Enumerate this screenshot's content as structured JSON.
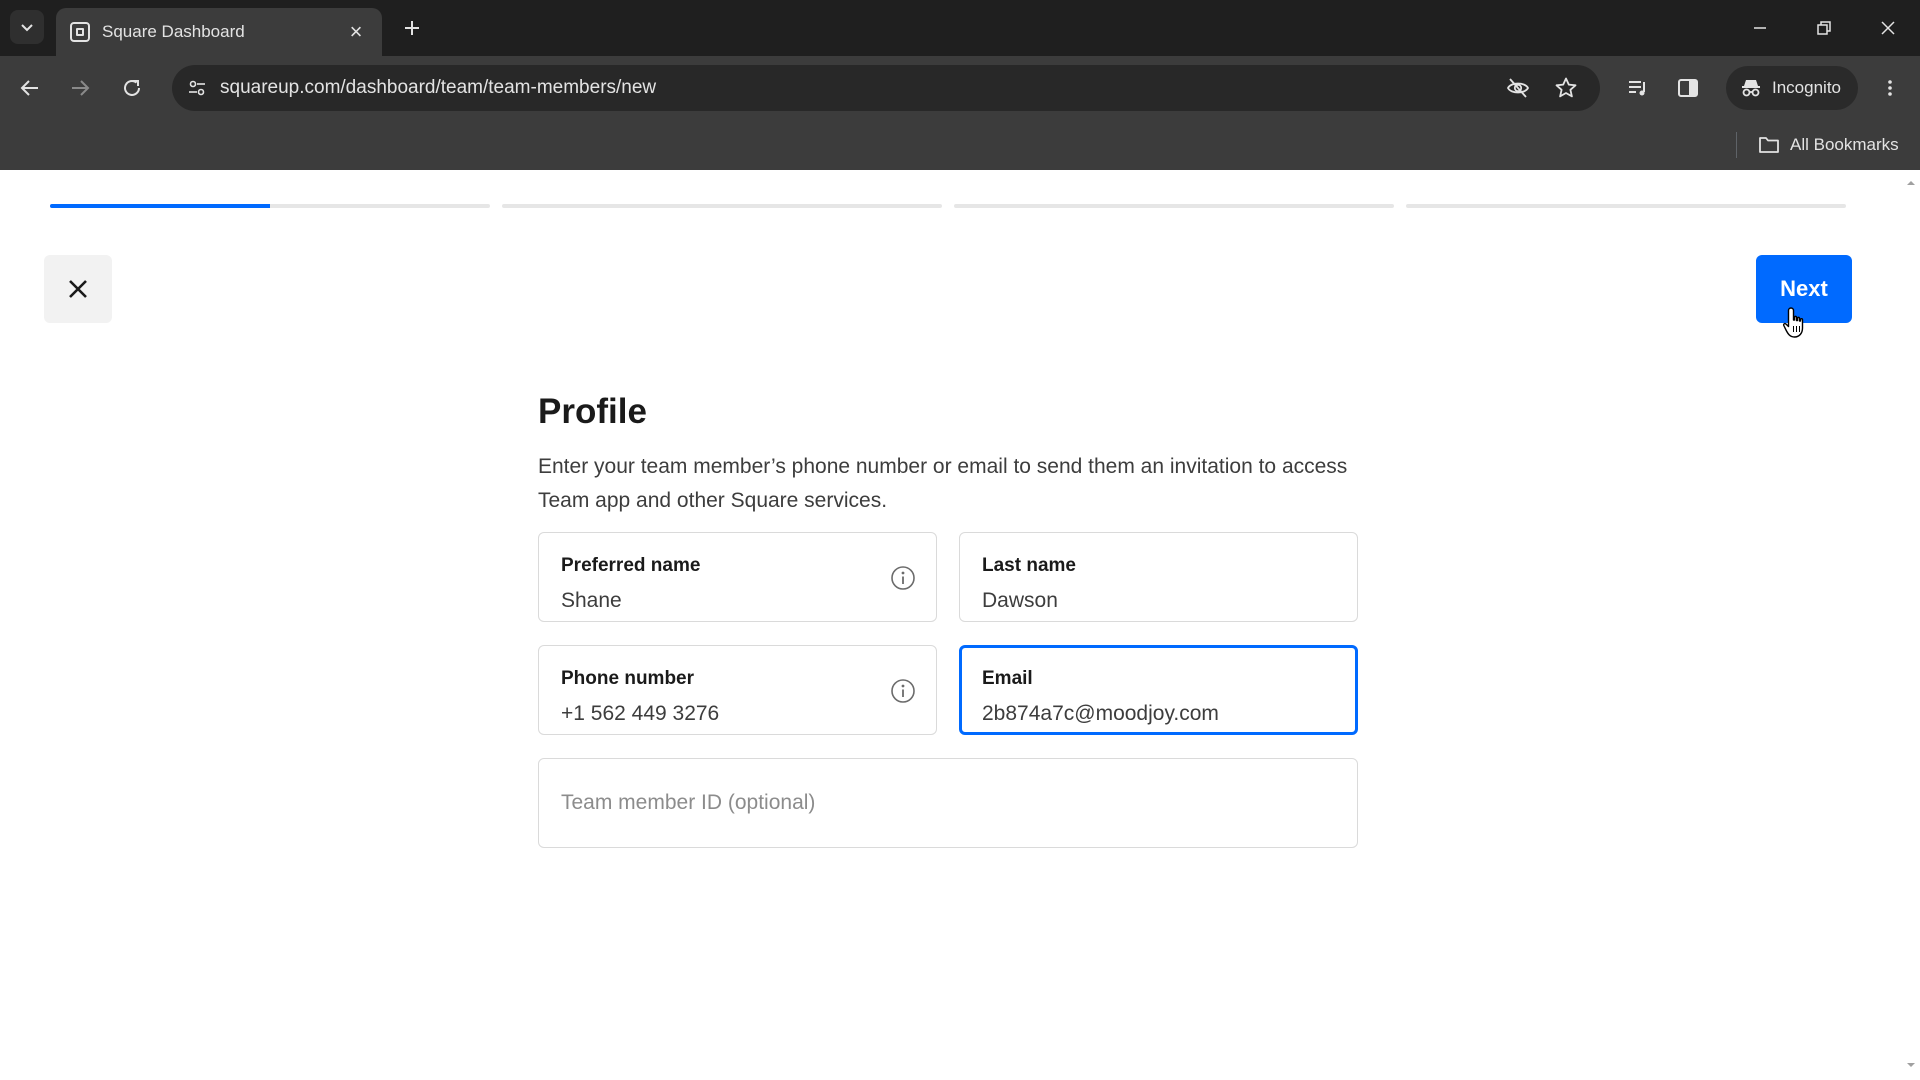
{
  "browser": {
    "tab_title": "Square Dashboard",
    "url": "squareup.com/dashboard/team/team-members/new",
    "incognito_label": "Incognito",
    "bookmarks_label": "All Bookmarks"
  },
  "wizard": {
    "steps_total": 4,
    "current_step": 1,
    "current_step_progress": 0.5,
    "next_label": "Next"
  },
  "profile": {
    "title": "Profile",
    "description": "Enter your team member’s phone number or email to send them an invitation to access Team app and other Square services.",
    "fields": {
      "preferred_name": {
        "label": "Preferred name",
        "value": "Shane"
      },
      "last_name": {
        "label": "Last name",
        "value": "Dawson"
      },
      "phone": {
        "label": "Phone number",
        "value": "+1 562 449 3276"
      },
      "email": {
        "label": "Email",
        "value": "2b874a7c@moodjoy.com"
      },
      "team_member_id": {
        "placeholder": "Team member ID (optional)"
      }
    }
  },
  "colors": {
    "accent": "#006aff",
    "chrome_dark": "#1f1f1f",
    "chrome_toolbar": "#3c3c3c"
  }
}
